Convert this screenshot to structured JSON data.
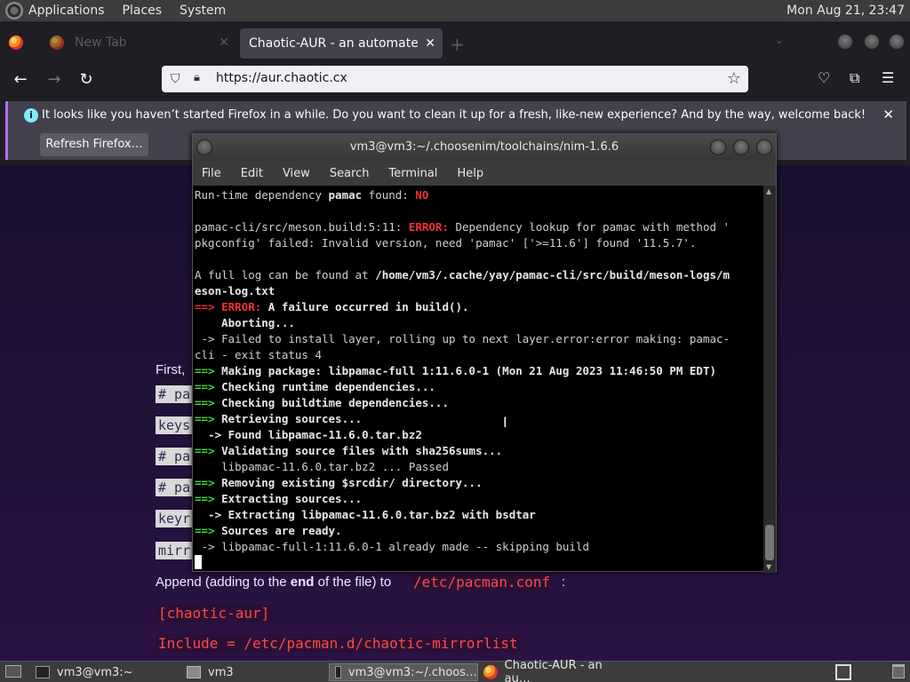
{
  "top_panel": {
    "menus": [
      "Applications",
      "Places",
      "System"
    ],
    "clock": "Mon Aug 21, 23:47"
  },
  "firefox": {
    "tabs": [
      {
        "label": "New Tab",
        "active": false
      },
      {
        "label": "Chaotic-AUR - an automated bu",
        "active": true
      }
    ],
    "url": "https://aur.chaotic.cx",
    "notification": {
      "message": "It looks like you haven’t started Firefox in a while. Do you want to clean it up for a fresh, like-new experience? And by the way, welcome back!",
      "button_label": "Refresh Firefox…"
    }
  },
  "webpage": {
    "first_text": "First,",
    "code_fragments": [
      "# pa",
      "keys",
      "# pa",
      "# pa",
      "keyr",
      "mirr"
    ],
    "append_text_1": "Append (adding to the ",
    "append_bold": "end",
    "append_text_2": " of the file) to ",
    "append_path": "/etc/pacman.conf",
    "append_colon": ":",
    "config_section": "[chaotic-aur]",
    "config_include": "Include = /etc/pacman.d/chaotic-mirrorlist"
  },
  "terminal": {
    "title": "vm3@vm3:~/.choosenim/toolchains/nim-1.6.6",
    "menu": [
      "File",
      "Edit",
      "View",
      "Search",
      "Terminal",
      "Help"
    ],
    "lines": [
      {
        "segments": [
          {
            "t": "Run-time dependency ",
            "c": ""
          },
          {
            "t": "pamac",
            "c": "b"
          },
          {
            "t": " found: ",
            "c": ""
          },
          {
            "t": "NO",
            "c": "r"
          }
        ]
      },
      {
        "segments": [
          {
            "t": " ",
            "c": ""
          }
        ]
      },
      {
        "segments": [
          {
            "t": "pamac-cli/src/meson.build:5:11: ",
            "c": ""
          },
          {
            "t": "ERROR:",
            "c": "r"
          },
          {
            "t": " Dependency lookup for pamac with method '",
            "c": ""
          }
        ]
      },
      {
        "segments": [
          {
            "t": "pkgconfig' failed: Invalid version, need 'pamac' ['>=11.6'] found '11.5.7'.",
            "c": ""
          }
        ]
      },
      {
        "segments": [
          {
            "t": " ",
            "c": ""
          }
        ]
      },
      {
        "segments": [
          {
            "t": "A full log can be found at ",
            "c": ""
          },
          {
            "t": "/home/vm3/.cache/yay/pamac-cli/src/build/meson-logs/m",
            "c": "b"
          }
        ]
      },
      {
        "segments": [
          {
            "t": "eson-log.txt",
            "c": "b"
          }
        ]
      },
      {
        "segments": [
          {
            "t": "==> ",
            "c": "r"
          },
          {
            "t": "ERROR:",
            "c": "r"
          },
          {
            "t": " A failure occurred in build().",
            "c": "b"
          }
        ]
      },
      {
        "segments": [
          {
            "t": "    Aborting...",
            "c": "b"
          }
        ]
      },
      {
        "segments": [
          {
            "t": " -> Failed to install layer, rolling up to next layer.error:error making: pamac-",
            "c": ""
          }
        ]
      },
      {
        "segments": [
          {
            "t": "cli - exit status 4",
            "c": ""
          }
        ]
      },
      {
        "segments": [
          {
            "t": "==> ",
            "c": "g"
          },
          {
            "t": "Making package: libpamac-full 1:11.6.0-1 (Mon 21 Aug 2023 11:46:50 PM EDT)",
            "c": "b"
          }
        ]
      },
      {
        "segments": [
          {
            "t": "==> ",
            "c": "g"
          },
          {
            "t": "Checking runtime dependencies...",
            "c": "b"
          }
        ]
      },
      {
        "segments": [
          {
            "t": "==> ",
            "c": "g"
          },
          {
            "t": "Checking buildtime dependencies...",
            "c": "b"
          }
        ]
      },
      {
        "segments": [
          {
            "t": "==> ",
            "c": "g"
          },
          {
            "t": "Retrieving sources...",
            "c": "b"
          }
        ]
      },
      {
        "segments": [
          {
            "t": "  -> ",
            "c": "b"
          },
          {
            "t": "Found libpamac-11.6.0.tar.bz2",
            "c": "b"
          }
        ]
      },
      {
        "segments": [
          {
            "t": "==> ",
            "c": "g"
          },
          {
            "t": "Validating source files with sha256sums...",
            "c": "b"
          }
        ]
      },
      {
        "segments": [
          {
            "t": "    libpamac-11.6.0.tar.bz2 ... Passed",
            "c": ""
          }
        ]
      },
      {
        "segments": [
          {
            "t": "==> ",
            "c": "g"
          },
          {
            "t": "Removing existing $srcdir/ directory...",
            "c": "b"
          }
        ]
      },
      {
        "segments": [
          {
            "t": "==> ",
            "c": "g"
          },
          {
            "t": "Extracting sources...",
            "c": "b"
          }
        ]
      },
      {
        "segments": [
          {
            "t": "  -> ",
            "c": "b"
          },
          {
            "t": "Extracting libpamac-11.6.0.tar.bz2 with bsdtar",
            "c": "b"
          }
        ]
      },
      {
        "segments": [
          {
            "t": "==> ",
            "c": "g"
          },
          {
            "t": "Sources are ready.",
            "c": "b"
          }
        ]
      },
      {
        "segments": [
          {
            "t": " -> libpamac-full-1:11.6.0-1 already made -- skipping build",
            "c": ""
          }
        ]
      }
    ]
  },
  "taskbar": {
    "tasks": [
      {
        "label": "vm3@vm3:~",
        "icon": "terminal-icon",
        "active": false
      },
      {
        "label": "vm3",
        "icon": "folder-icon",
        "active": false
      },
      {
        "label": "vm3@vm3:~/.choos…",
        "icon": "terminal-icon",
        "active": true
      },
      {
        "label": "Chaotic-AUR - an au…",
        "icon": "firefox-icon",
        "active": false
      }
    ]
  }
}
